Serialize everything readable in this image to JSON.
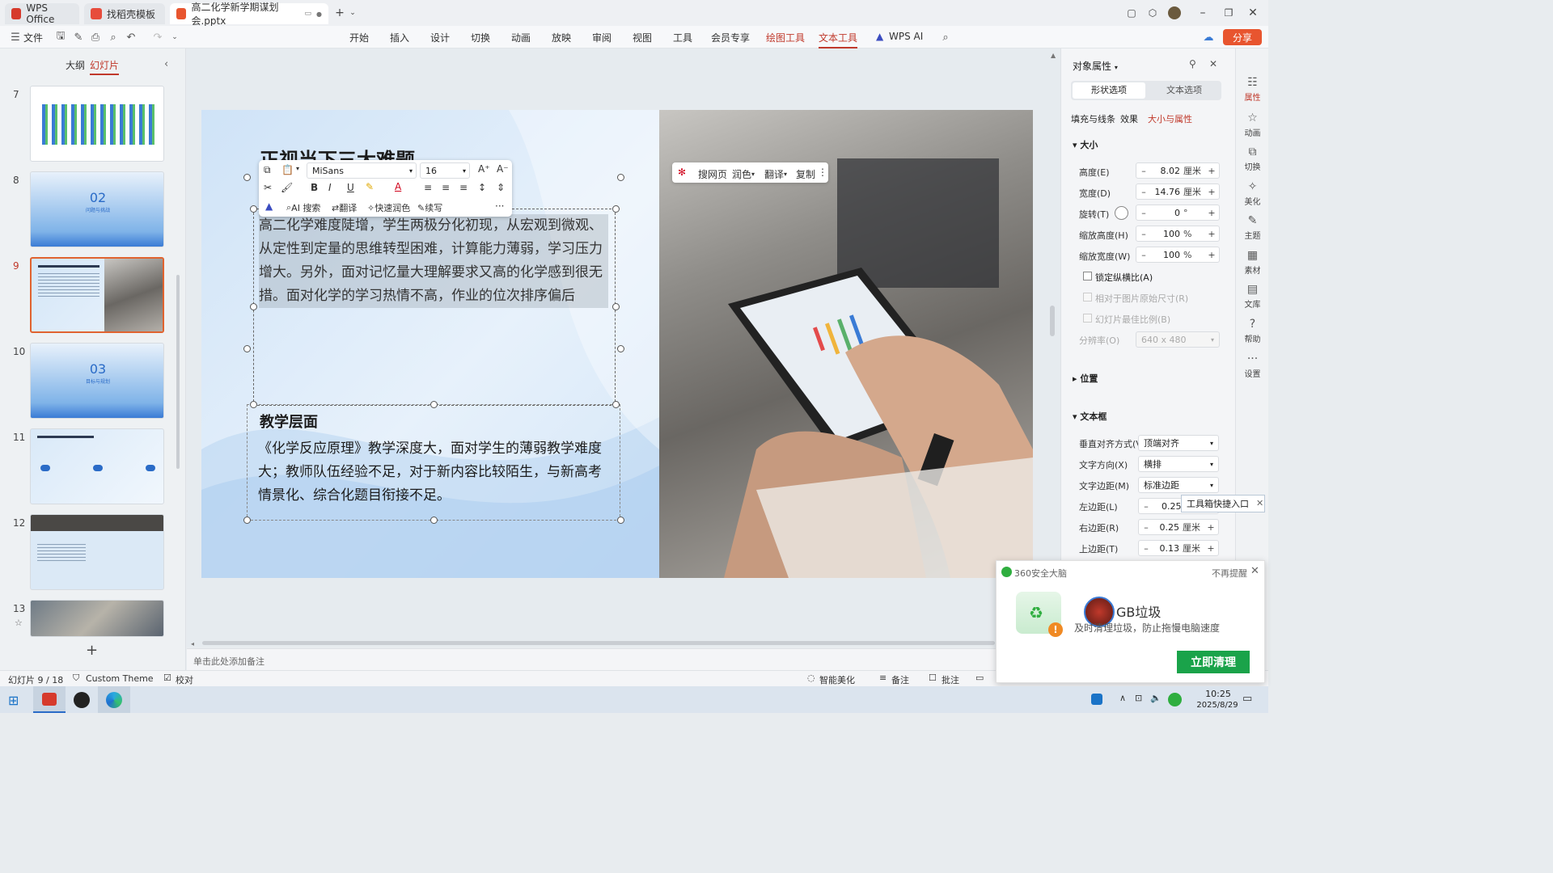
{
  "titlebar": {
    "tabs": [
      {
        "label": "WPS Office"
      },
      {
        "label": "找稻壳模板"
      },
      {
        "label": "高二化学新学期谋划会.pptx"
      }
    ],
    "new_tab": "+"
  },
  "ribbon": {
    "file_menu": "文件",
    "tabs": [
      "开始",
      "插入",
      "设计",
      "切换",
      "动画",
      "放映",
      "审阅",
      "视图",
      "工具",
      "会员专享",
      "绘图工具",
      "文本工具",
      "WPS AI"
    ],
    "share": "分享"
  },
  "left_panel": {
    "tab_outline": "大纲",
    "tab_slides": "幻灯片",
    "slides": [
      {
        "num": "7"
      },
      {
        "num": "8",
        "text": "02",
        "sub": "问题与挑战"
      },
      {
        "num": "9"
      },
      {
        "num": "10",
        "text": "03",
        "sub": "目标与规划"
      },
      {
        "num": "11"
      },
      {
        "num": "12"
      },
      {
        "num": "13"
      }
    ],
    "add": "+"
  },
  "slide": {
    "title": "正视当下三大难题",
    "para1": "高二化学难度陡增，学生两极分化初现，从宏观到微观、从定性到定量的思维转型困难，计算能力薄弱，学习压力增大。另外，面对记忆量大理解要求又高的化学感到很无措。面对化学的学习热情不高，作业的位次排序偏后",
    "heading2": "教学层面",
    "para2": "《化学反应原理》教学深度大，面对学生的薄弱教学难度大；教师队伍经验不足，对于新内容比较陌生，与新高考情景化、综合化题目衔接不足。"
  },
  "format_toolbar": {
    "font": "MiSans",
    "size": "16",
    "ai_search": "AI 搜索",
    "translate": "翻译",
    "polish": "快速润色",
    "continue": "续写",
    "more": "···"
  },
  "context_toolbar": {
    "search": "搜网页",
    "polish": "润色",
    "translate": "翻译",
    "copy": "复制"
  },
  "right_panel": {
    "title": "对象属性",
    "tab_shape": "形状选项",
    "tab_text": "文本选项",
    "subtabs": [
      "填充与线条",
      "效果",
      "大小与属性"
    ],
    "section_size": "大小",
    "height_label": "高度(E)",
    "height_val": "8.02",
    "height_unit": "厘米",
    "width_label": "宽度(D)",
    "width_val": "14.76",
    "width_unit": "厘米",
    "rotate_label": "旋转(T)",
    "rotate_val": "0",
    "rotate_unit": "°",
    "scale_h_label": "缩放高度(H)",
    "scale_h_val": "100",
    "scale_h_unit": "%",
    "scale_w_label": "缩放宽度(W)",
    "scale_w_val": "100",
    "scale_w_unit": "%",
    "lock_ratio": "锁定纵横比(A)",
    "relative_orig": "相对于图片原始尺寸(R)",
    "best_ratio": "幻灯片最佳比例(B)",
    "resolution_label": "分辨率(O)",
    "resolution_val": "640 x 480",
    "section_position": "位置",
    "section_textbox": "文本框",
    "valign_label": "垂直对齐方式(V)",
    "valign_val": "顶端对齐",
    "direction_label": "文字方向(X)",
    "direction_val": "横排",
    "margin_label": "文字边距(M)",
    "margin_val": "标准边距",
    "left_margin_label": "左边距(L)",
    "left_margin_val": "0.25",
    "right_margin_label": "右边距(R)",
    "right_margin_val": "0.25",
    "right_margin_unit": "厘米",
    "top_margin_label": "上边距(T)",
    "top_margin_val": "0.13",
    "top_margin_unit": "厘米"
  },
  "icon_bar": [
    "属性",
    "动画",
    "切换",
    "美化",
    "主题",
    "素材",
    "文库",
    "帮助",
    "设置"
  ],
  "notes_placeholder": "单击此处添加备注",
  "status": {
    "slide_counter": "幻灯片 9 / 18",
    "theme": "Custom Theme",
    "proof": "校对",
    "smart": "智能美化",
    "notes": "备注",
    "comment": "批注"
  },
  "tooltip": "工具箱快捷入口",
  "popup": {
    "brand": "360安全大脑",
    "dismiss": "不再提醒",
    "headline": "GB垃圾",
    "desc": "及时清理垃圾，防止拖慢电脑速度",
    "button": "立即清理"
  },
  "taskbar": {
    "time": "10:25",
    "date": "2025/8/29"
  },
  "colors": {
    "accent": "#c0392b",
    "share": "#e8552f",
    "clean_button": "#1aa34a"
  }
}
